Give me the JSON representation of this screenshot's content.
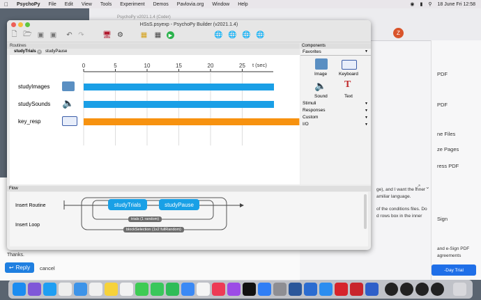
{
  "menubar": {
    "app_name": "PsychoPy",
    "items": [
      "File",
      "Edit",
      "View",
      "Tools",
      "Experiment",
      "Demos",
      "Pavlovia.org",
      "Window",
      "Help"
    ],
    "datetime": "18 June Fri  12:58"
  },
  "browser": {
    "tab_text": "PsychoPy v2021.1.4 (Coder)",
    "side_items": [
      "PDF",
      "PDF",
      "ne Files",
      "ze Pages",
      "ress PDF",
      "Sign",
      "and e-Sign PDF",
      "agreements"
    ],
    "trial_button": "-Day Trial",
    "avatar_letter": "Z",
    "snippet": [
      "ge), and I want the inner",
      "amiliar language.",
      "of the conditions files. Do",
      "d rows box in the inner"
    ]
  },
  "forum": {
    "thanks": "Thanks.",
    "reply_label": "Reply",
    "cancel_label": "cancel"
  },
  "window": {
    "title": "HSsS.psyexp - PsychoPy Builder (v2021.1.4)"
  },
  "routines": {
    "panel_title": "Routines",
    "tabs": [
      "studyTrials",
      "studyPause"
    ],
    "time_unit": "t (sec)",
    "ticks": [
      "0",
      "5",
      "10",
      "15",
      "20",
      "25"
    ],
    "components": [
      {
        "name": "studyImages",
        "end": 30
      },
      {
        "name": "studySounds",
        "end": 30
      },
      {
        "name": "key_resp",
        "end": 34
      }
    ]
  },
  "components_panel": {
    "title": "Components",
    "favorites_label": "Favorites",
    "favorites": [
      "Image",
      "Keyboard",
      "Sound",
      "Text"
    ],
    "categories": [
      "Stimuli",
      "Responses",
      "Custom",
      "I/O"
    ]
  },
  "flow": {
    "title": "Flow",
    "insert_routine": "Insert Routine",
    "insert_loop": "Insert Loop",
    "routines": [
      "studyTrials",
      "studyPause"
    ],
    "inner_loop": "trials  (1 random)",
    "outer_loop": "blockSelection  (1x2 fullRandom)"
  },
  "colors": {
    "bar_blue": "#1a9fe6",
    "bar_orange": "#f7920f",
    "pill_blue": "#19a0e6"
  }
}
